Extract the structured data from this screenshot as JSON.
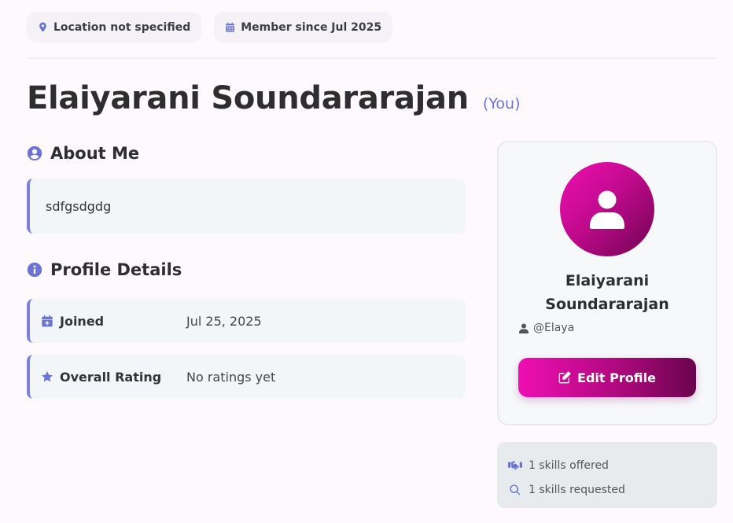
{
  "meta": {
    "location": "Location not specified",
    "member_since": "Member since Jul 2025"
  },
  "profile": {
    "name": "Elaiyarani Soundararajan",
    "you_tag": "(You)"
  },
  "about": {
    "title": "About Me",
    "text": "sdfgsdgdg"
  },
  "details": {
    "title": "Profile Details",
    "joined_label": "Joined",
    "joined_value": "Jul 25, 2025",
    "rating_label": "Overall Rating",
    "rating_value": "No ratings yet"
  },
  "card": {
    "name_line1": "Elaiyarani",
    "name_line2": "Soundararajan",
    "handle": "@Elaya",
    "edit_label": "Edit Profile"
  },
  "stats": {
    "offered": "1 skills offered",
    "requested": "1 skills requested"
  },
  "colors": {
    "accent": "#6b74d6",
    "brand_start": "#ef0fb2",
    "brand_end": "#6a044e"
  },
  "icons": {
    "location": "map-pin-icon",
    "calendar": "calendar-icon",
    "about": "user-circle-icon",
    "info": "info-circle-icon",
    "joined": "calendar-plus-icon",
    "rating": "star-icon",
    "avatar": "user-icon",
    "handle": "user-small-icon",
    "edit": "edit-icon",
    "offered": "handshake-icon",
    "requested": "search-icon"
  }
}
